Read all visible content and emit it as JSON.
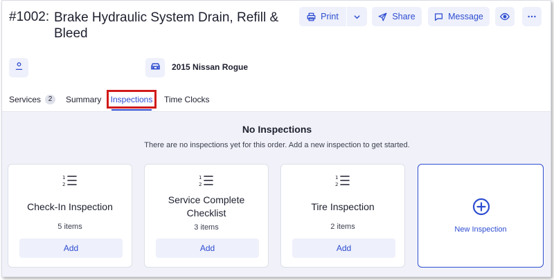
{
  "header": {
    "order_number": "#1002:",
    "order_title": "Brake Hydraulic System Drain, Refill & Bleed"
  },
  "toolbar": {
    "print_label": "Print",
    "share_label": "Share",
    "message_label": "Message"
  },
  "info": {
    "vehicle": "2015 Nissan Rogue"
  },
  "tabs": [
    {
      "label": "Services",
      "badge": "2"
    },
    {
      "label": "Summary"
    },
    {
      "label": "Inspections",
      "active": true
    },
    {
      "label": "Time Clocks"
    }
  ],
  "inspections": {
    "empty_title": "No Inspections",
    "empty_message": "There are no inspections yet for this order. Add a new inspection to get started.",
    "cards": [
      {
        "title": "Check-In Inspection",
        "count": "5 items",
        "add_label": "Add"
      },
      {
        "title": "Service Complete Checklist",
        "count": "3 items",
        "add_label": "Add"
      },
      {
        "title": "Tire Inspection",
        "count": "2 items",
        "add_label": "Add"
      }
    ],
    "new_label": "New Inspection"
  },
  "colors": {
    "accent": "#2d4dd1",
    "button_bg": "#eef0fb",
    "content_bg": "#f1f2f9",
    "highlight": "#d11a1a"
  },
  "icons": [
    "printer-icon",
    "chevron-down-icon",
    "send-icon",
    "message-icon",
    "eye-icon",
    "more-icon",
    "person-icon",
    "car-icon",
    "numbered-list-icon",
    "plus-circle-icon"
  ]
}
